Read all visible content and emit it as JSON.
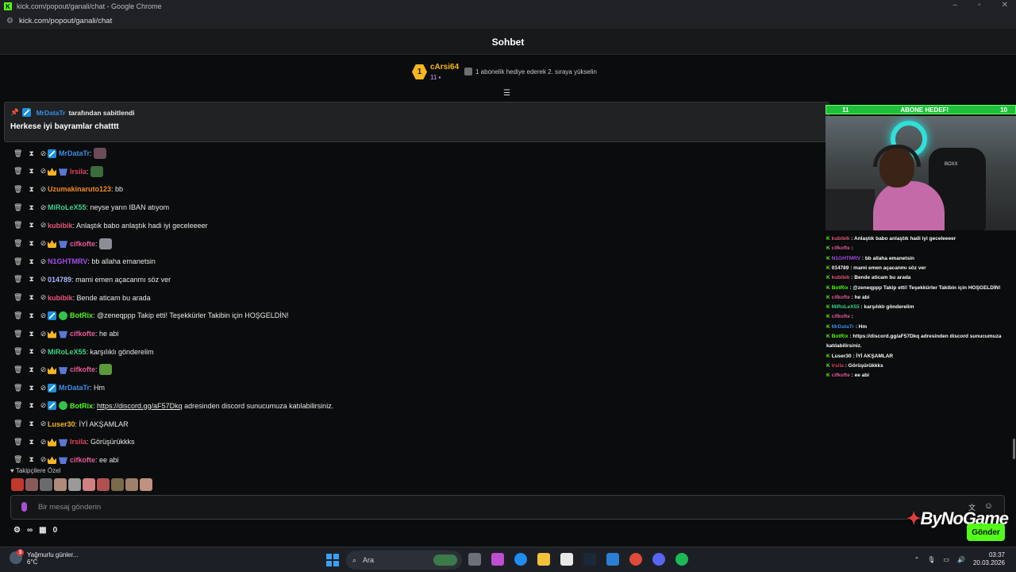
{
  "window": {
    "title": "kick.com/popout/ganali/chat - Google Chrome",
    "url": "kick.com/popout/ganali/chat",
    "app_icon": "K"
  },
  "header": {
    "title": "Sohbet"
  },
  "top_gifter": {
    "rank": "1",
    "name": "cArsi64",
    "count": "11",
    "promo": "1 abonelik hediye ederek 2. sıraya yükselin"
  },
  "pinned": {
    "user": "MrDataTr",
    "suffix": "tarafından sabitlendi",
    "message": "Herkese iyi bayramlar chatttt"
  },
  "messages": [
    {
      "user": "MrDataTr",
      "color": "#3a8ee6",
      "badges": [
        "mod"
      ],
      "sep": ":",
      "text": "",
      "emote": "#6b4a5a"
    },
    {
      "user": "Irsila",
      "color": "#e0405a",
      "badges": [
        "crown",
        "sub"
      ],
      "sep": ":",
      "text": "",
      "emote": "#3c6b3c"
    },
    {
      "user": "Uzumakinaruto123",
      "color": "#f08a2a",
      "badges": [],
      "sep": ":",
      "text": " bb",
      "emote": null
    },
    {
      "user": "MiRoLeX55",
      "color": "#3cd28a",
      "badges": [],
      "sep": ":",
      "text": " neyse yarın IBAN atıyom",
      "emote": null
    },
    {
      "user": "kubibik",
      "color": "#e8567a",
      "badges": [],
      "sep": ":",
      "text": " Anlaştık babo anlaştık hadi iyi geceleeeer",
      "emote": null
    },
    {
      "user": "cifkofte",
      "color": "#e85a9a",
      "badges": [
        "crown",
        "sub"
      ],
      "sep": ":",
      "text": "",
      "emote": "#8a8f96"
    },
    {
      "user": "N1GHTMRV",
      "color": "#a64cf0",
      "badges": [],
      "sep": ":",
      "text": " bb allaha emanetsin",
      "emote": null
    },
    {
      "user": "014789",
      "color": "#a9b6ff",
      "badges": [],
      "sep": ":",
      "text": " mami emen açacanmı söz ver",
      "emote": null
    },
    {
      "user": "kubibik",
      "color": "#e8567a",
      "badges": [],
      "sep": ":",
      "text": " Bende aticam bu arada",
      "emote": null
    },
    {
      "user": "BotRix",
      "color": "#53fc18",
      "badges": [
        "mod",
        "ver"
      ],
      "sep": ":",
      "text": " @zeneqppp Takip etti! Teşekkürler Takibin için HOŞGELDİN!",
      "emote": null
    },
    {
      "user": "cifkofte",
      "color": "#e85a9a",
      "badges": [
        "crown",
        "sub"
      ],
      "sep": ":",
      "text": " he abi",
      "emote": null
    },
    {
      "user": "MiRoLeX55",
      "color": "#3cd28a",
      "badges": [],
      "sep": ":",
      "text": " karşılıklı gönderelim",
      "emote": null
    },
    {
      "user": "cifkofte",
      "color": "#e85a9a",
      "badges": [
        "crown",
        "sub"
      ],
      "sep": ":",
      "text": "",
      "emote": "#5a9a3a"
    },
    {
      "user": "MrDataTr",
      "color": "#3a8ee6",
      "badges": [
        "mod"
      ],
      "sep": ":",
      "text": " Hm",
      "emote": null
    },
    {
      "user": "BotRix",
      "color": "#53fc18",
      "badges": [
        "mod",
        "ver"
      ],
      "sep": ":",
      "text": " adresinden discord sunucumuza katılabilirsiniz.",
      "link": "https://discord.gg/aF57Dkq",
      "emote": null
    },
    {
      "user": "Luser30",
      "color": "#f5b622",
      "badges": [],
      "sep": ":",
      "text": " İYİ AKŞAMLAR",
      "emote": null
    },
    {
      "user": "Irsila",
      "color": "#e0405a",
      "badges": [
        "crown",
        "sub"
      ],
      "sep": ":",
      "text": " Görüşürükkks",
      "emote": null
    },
    {
      "user": "cifkofte",
      "color": "#e85a9a",
      "badges": [
        "crown",
        "sub"
      ],
      "sep": ":",
      "text": " ee abi",
      "emote": null
    }
  ],
  "followers_only": "Takipçilere Özel",
  "input": {
    "placeholder": "Bir mesaj gönderin",
    "send_label": "Gönder"
  },
  "bottom": {
    "infinity": "∞",
    "count": "0"
  },
  "overlay": {
    "goal_left": "11",
    "goal_title": "ABONE HEDEF!",
    "goal_right": "10",
    "logo": "ByNoGame",
    "chair_brand": "BOXX",
    "lines": [
      {
        "user": "kubibik",
        "color": "#e8567a",
        "text": " : Anlaştık babo anlaştık hadi iyi geceleeeer"
      },
      {
        "user": "cifkofte",
        "color": "#e85a9a",
        "text": " : "
      },
      {
        "user": "N1GHTMRV",
        "color": "#a64cf0",
        "text": " : bb allaha emanetsin"
      },
      {
        "user": "014789",
        "color": "#ffffff",
        "text": " : mami emen açacanmı söz ver"
      },
      {
        "user": "kubibik",
        "color": "#e8567a",
        "text": " : Bende aticam bu arada"
      },
      {
        "user": "BotRix",
        "color": "#53fc18",
        "text": " : @zeneqppp Takip etti! Teşekkürler Takibin için HOŞGELDİN!"
      },
      {
        "user": "cifkofte",
        "color": "#e85a9a",
        "text": " : he abi"
      },
      {
        "user": "MiRoLeX55",
        "color": "#3cd28a",
        "text": " : karşılıklı gönderelim"
      },
      {
        "user": "cifkofte",
        "color": "#e85a9a",
        "text": " : "
      },
      {
        "user": "MrDataTr",
        "color": "#3a8ee6",
        "text": " : Hm"
      },
      {
        "user": "BotRix",
        "color": "#53fc18",
        "text": " : https://discord.gg/aF57Dkq adresinden discord sunucumuza"
      },
      {
        "user": "",
        "color": "#ffffff",
        "text": "katılabilirsiniz."
      },
      {
        "user": "Luser30",
        "color": "#ffffff",
        "text": " : İYİ AKŞAMLAR"
      },
      {
        "user": "Irsila",
        "color": "#e0405a",
        "text": " : Görüşürükkks"
      },
      {
        "user": "cifkofte",
        "color": "#e85a9a",
        "text": " : ee abi"
      }
    ]
  },
  "taskbar": {
    "weather_title": "Yağmurlu günler...",
    "weather_temp": "6°C",
    "weather_badge": "3",
    "search": "Ara",
    "time": "03:37",
    "date": "20.03.2026"
  }
}
